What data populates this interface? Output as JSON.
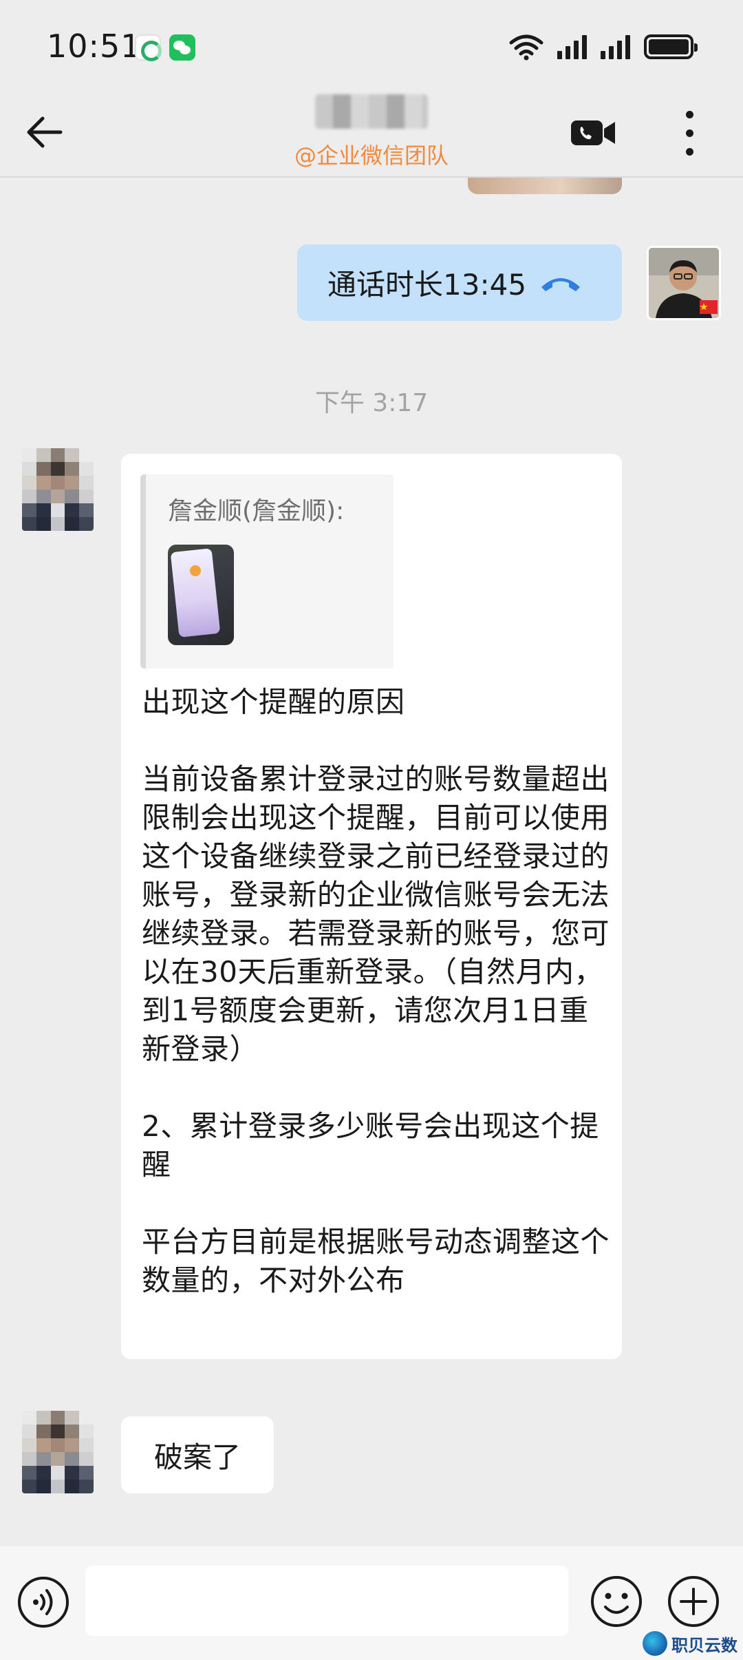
{
  "status_bar": {
    "time": "10:51",
    "icons": [
      "app-notification-icon",
      "wechat-icon",
      "wifi-icon",
      "signal-icon",
      "signal-icon",
      "battery-icon"
    ]
  },
  "header": {
    "title": "",
    "subtitle": "@企业微信团队",
    "icons": [
      "back-arrow-icon",
      "video-call-icon",
      "more-vert-icon"
    ]
  },
  "messages": {
    "call": {
      "text": "通话时长13:45",
      "icon": "phone-hangup-icon",
      "accent": "#2f7fe0"
    },
    "timestamp": "下午 3:17",
    "reply": {
      "quote_author": "詹金顺(詹金顺):",
      "paragraphs": [
        "出现这个提醒的原因",
        "",
        "当前设备累计登录过的账号数量超出限制会出现这个提醒，目前可以使用这个设备继续登录之前已经登录过的账号，登录新的企业微信账号会无法继续登录。若需登录新的账号，您可以在30天后重新登录。（自然月内，到1号额度会更新，请您次月1日重新登录）",
        "",
        "2、累计登录多少账号会出现这个提醒",
        "",
        "平台方目前是根据账号动态调整这个数量的，不对外公布"
      ]
    },
    "short": {
      "text": "破案了"
    }
  },
  "input_bar": {
    "placeholder": "",
    "icons": [
      "voice-icon",
      "emoji-icon",
      "plus-icon"
    ]
  },
  "watermark": {
    "text": "职贝云数"
  },
  "colors": {
    "background": "#ededed",
    "bubble_self": "#c4e1fb",
    "bubble_other": "#ffffff",
    "subtitle": "#f08a3c"
  }
}
